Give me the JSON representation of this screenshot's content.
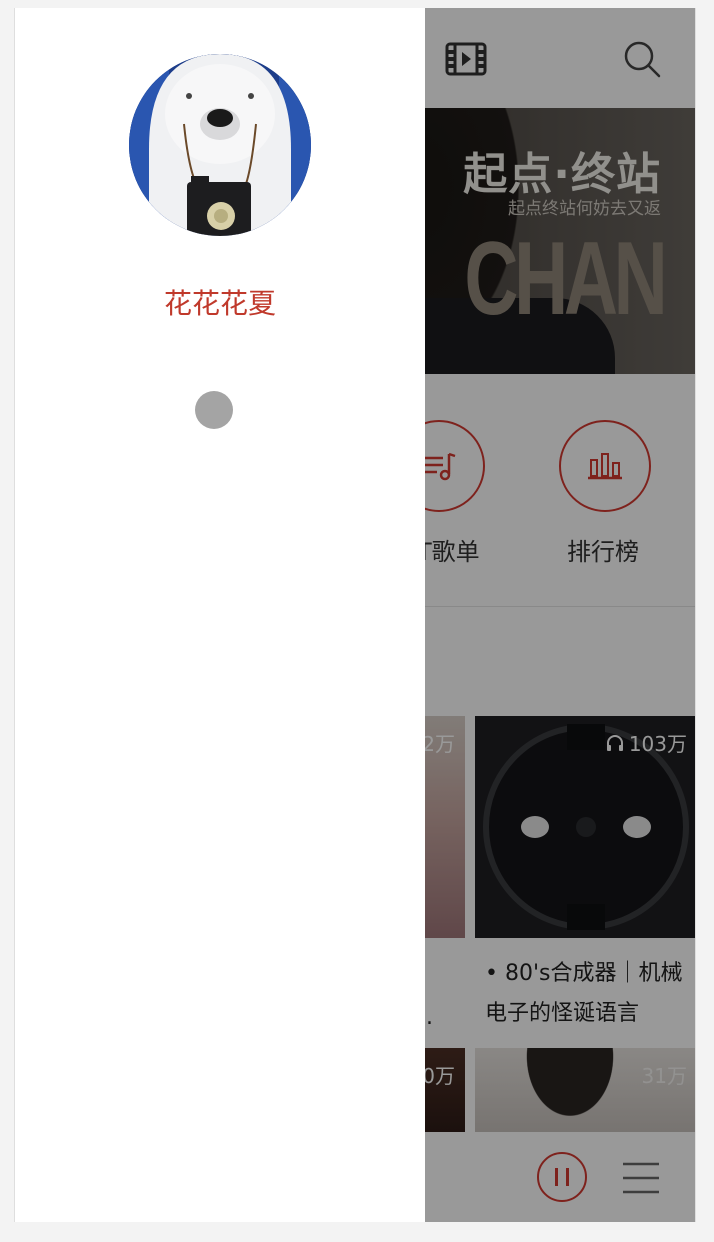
{
  "header": {
    "video_icon": "video-icon",
    "search_icon": "search-icon"
  },
  "banner": {
    "title": "起点·终站",
    "subtitle": "起点终站何妨去又返",
    "big_text": "CHAN"
  },
  "quick_entries": [
    {
      "label": "T歌单",
      "icon": "music-list-icon"
    },
    {
      "label": "排行榜",
      "icon": "chart-bars-icon"
    }
  ],
  "playlists": [
    {
      "count": "2万",
      "title_line2": ".."
    },
    {
      "count": "103万",
      "title_line1": "• 80's合成器｜机械",
      "title_line2": "电子的怪诞语言"
    },
    {
      "count": "0万"
    },
    {
      "count": "31万"
    }
  ],
  "bottom_bar": {
    "pause_icon": "pause-icon",
    "menu_icon": "menu-icon"
  },
  "drawer": {
    "username": "花花花夏",
    "avatar": "avatar-polar-bear-camera"
  },
  "colors": {
    "accent": "#d33a31",
    "username": "#c0392b",
    "overlay": "rgba(0,0,0,0.40)"
  }
}
